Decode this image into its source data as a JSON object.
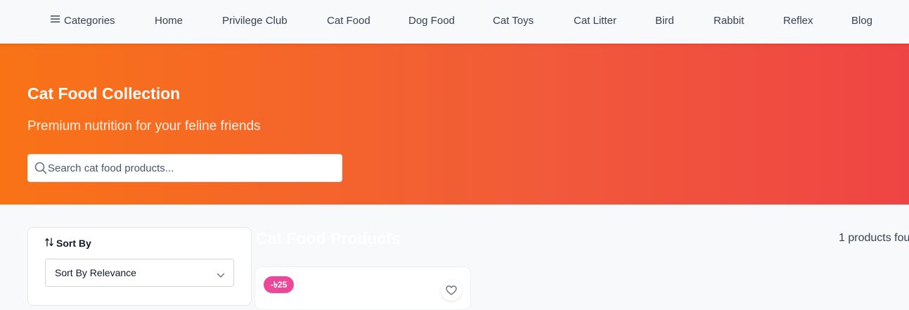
{
  "nav": {
    "categories_label": "Categories",
    "items": [
      "Home",
      "Privilege Club",
      "Cat Food",
      "Dog Food",
      "Cat Toys",
      "Cat Litter",
      "Bird",
      "Rabbit",
      "Reflex",
      "Blog"
    ],
    "categories_icon": "hamburger-menu-icon"
  },
  "hero": {
    "title": "Cat Food Collection",
    "subtitle": "Premium nutrition for your feline friends",
    "search": {
      "placeholder": "Search cat food products...",
      "value": "",
      "icon": "search-icon"
    },
    "gradient_start": "#f97316",
    "gradient_end": "#ef4444"
  },
  "sidebar": {
    "sort_label": "Sort By",
    "sort_icon": "sort-arrows-icon",
    "sort_selected": "Sort By Relevance"
  },
  "products": {
    "title": "Cat Food Products",
    "count_text": "1 products fou",
    "cards": [
      {
        "discount_badge": "-৳25",
        "wishlist_icon": "heart-icon"
      }
    ]
  },
  "colors": {
    "badge": "#ec4899",
    "text_dark": "#111827"
  }
}
